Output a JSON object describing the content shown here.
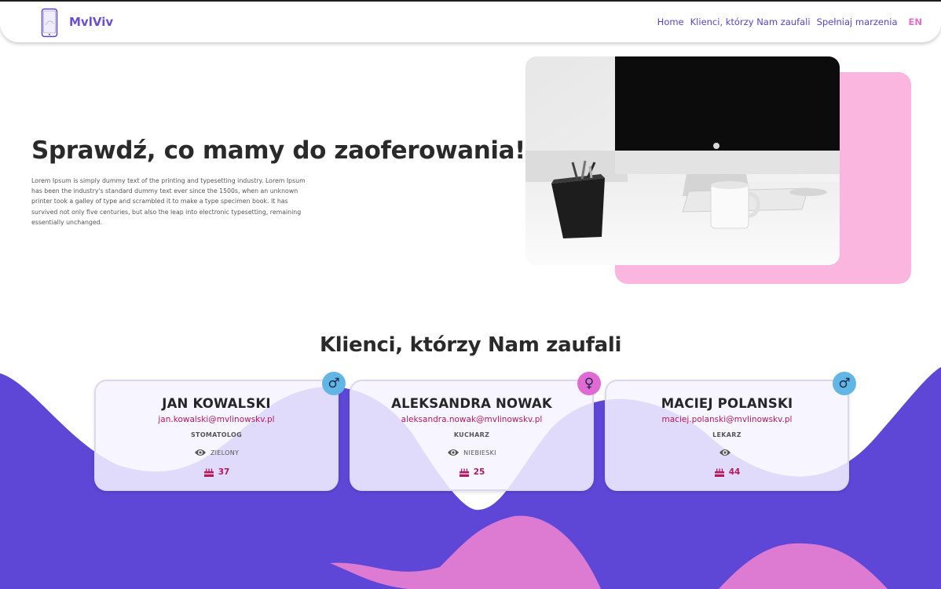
{
  "header": {
    "brand": "MvlViv",
    "nav": [
      "Home",
      "Klienci, którzy Nam zaufali",
      "Spełniaj marzenia"
    ],
    "lang": "EN"
  },
  "hero": {
    "title": "Sprawdź, co mamy do zaoferowania!",
    "text": "Lorem Ipsum is simply dummy text of the printing and typesetting industry. Lorem Ipsum has been the industry's standard dummy text ever since the 1500s, when an unknown printer took a galley of type and scrambled it to make a type specimen book. It has survived not only five centuries, but also the leap into electronic typesetting, remaining essentially unchanged."
  },
  "clients": {
    "title": "Klienci, którzy Nam zaufali",
    "cards": [
      {
        "name": "JAN KOWALSKI",
        "email": "jan.kowalski@mvlinowskv.pl",
        "job": "STOMATOLOG",
        "eyes": "ZIELONY",
        "age": "37",
        "gender_symbol": "♂",
        "gender": "male"
      },
      {
        "name": "ALEKSANDRA NOWAK",
        "email": "aleksandra.nowak@mvlinowskv.pl",
        "job": "KUCHARZ",
        "eyes": "NIEBIESKI",
        "age": "25",
        "gender_symbol": "♀",
        "gender": "female"
      },
      {
        "name": "MACIEJ POLANSKI",
        "email": "maciej.polanski@mvlinowskv.pl",
        "job": "LEKARZ",
        "eyes": "",
        "age": "44",
        "gender_symbol": "♂",
        "gender": "male"
      }
    ]
  },
  "colors": {
    "brand": "#6a4fd0",
    "accent_pink": "#fbb6e0",
    "wave_purple": "#5e47d7",
    "wave_pink": "#dd7bd3",
    "email": "#b3195d",
    "male_badge": "#62b6e6",
    "female_badge": "#e06ad3"
  },
  "icons": {
    "logo": "phone-logo-icon",
    "eye": "eye-icon",
    "age": "birthday-cake-icon",
    "male": "male-symbol-icon",
    "female": "female-symbol-icon"
  }
}
